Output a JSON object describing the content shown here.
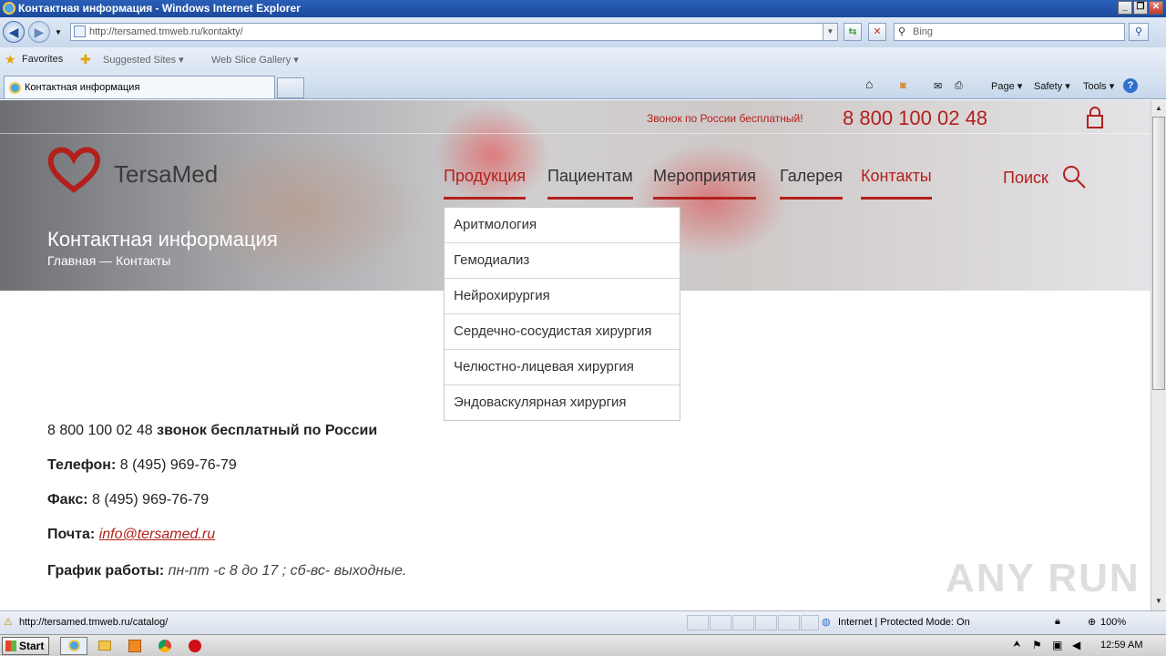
{
  "browser": {
    "window_title": "Контактная информация - Windows Internet Explorer",
    "url": "http://tersamed.tmweb.ru/kontakty/",
    "search_placeholder": "Bing",
    "favorites_label": "Favorites",
    "suggested_sites": "Suggested Sites ▾",
    "web_slice_gallery": "Web Slice Gallery ▾",
    "tab_title": "Контактная информация",
    "commands": {
      "page": "Page ▾",
      "safety": "Safety ▾",
      "tools": "Tools ▾",
      "help": "?"
    },
    "status_url": "http://tersamed.tmweb.ru/catalog/",
    "zone": "Internet | Protected Mode: On",
    "zoom": "100%",
    "start": "Start",
    "clock": "12:59 AM"
  },
  "site": {
    "free_call_label": "Звонок по России бесплатный!",
    "phone": "8 800 100 02 48",
    "logo_text": "TersaMed",
    "nav": [
      {
        "label": "Продукция"
      },
      {
        "label": "Пациентам"
      },
      {
        "label": "Мероприятия"
      },
      {
        "label": "Галерея"
      },
      {
        "label": "Контакты"
      }
    ],
    "search_label": "Поиск",
    "page_heading": "Контактная информация",
    "breadcrumb": "Главная  —  Контакты",
    "dropdown": [
      "Аритмология",
      "Гемодиализ",
      "Нейрохирургия",
      "Сердечно-сосудистая хирургия",
      "Челюстно-лицевая хирургия",
      "Эндоваскулярная хирургия"
    ],
    "contacts": {
      "free_phone": "8 800 100 02 48",
      "free_phone_label": "звонок бесплатный по России",
      "phone_label": "Телефон:",
      "phone_value": "8 (495) 969-76-79",
      "fax_label": "Факс:",
      "fax_value": "8 (495) 969-76-79",
      "email_label": "Почта:",
      "email_value": "info@tersamed.ru",
      "hours_label": "График работы:",
      "hours_value": "пн-пт -с 8 до 17 ; сб-вс- выходные."
    },
    "watermark": "ANY RUN"
  },
  "colors": {
    "accent": "#b3201c",
    "ie_titlebar": "#2a5fb8"
  }
}
